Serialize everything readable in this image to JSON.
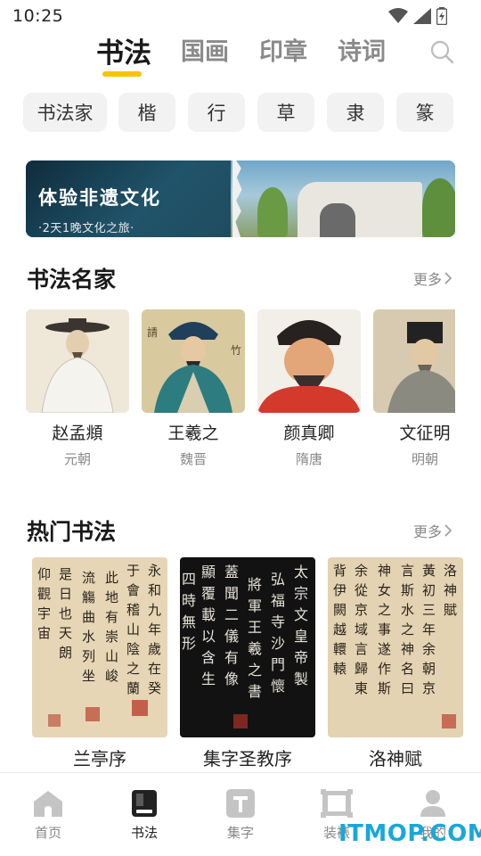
{
  "status": {
    "time": "10:25"
  },
  "tabs": [
    {
      "label": "书法",
      "active": true
    },
    {
      "label": "国画"
    },
    {
      "label": "印章"
    },
    {
      "label": "诗词"
    }
  ],
  "chips": [
    "书法家",
    "楷",
    "行",
    "草",
    "隶",
    "篆"
  ],
  "banner": {
    "title": "体验非遗文化",
    "subtitle": "·2天1晚文化之旅·"
  },
  "masters_section": {
    "title": "书法名家",
    "more": "更多",
    "items": [
      {
        "name": "赵孟頫",
        "era": "元朝"
      },
      {
        "name": "王羲之",
        "era": "魏晋"
      },
      {
        "name": "颜真卿",
        "era": "隋唐"
      },
      {
        "name": "文征明",
        "era": "明朝"
      }
    ]
  },
  "hot_section": {
    "title": "热门书法",
    "more": "更多",
    "items": [
      {
        "title": "兰亭序"
      },
      {
        "title": "集字圣教序"
      },
      {
        "title": "洛神赋"
      }
    ]
  },
  "bottom_nav": [
    {
      "label": "首页",
      "icon": "home-icon"
    },
    {
      "label": "书法",
      "icon": "book-icon",
      "active": true
    },
    {
      "label": "集字",
      "icon": "text-t-icon"
    },
    {
      "label": "装裱",
      "icon": "frame-icon"
    },
    {
      "label": "我的",
      "icon": "user-icon"
    }
  ],
  "watermark": "ITMOP.COM",
  "colors": {
    "accent": "#f6c400",
    "chip_bg": "#f2f2f2",
    "muted": "#888888"
  }
}
